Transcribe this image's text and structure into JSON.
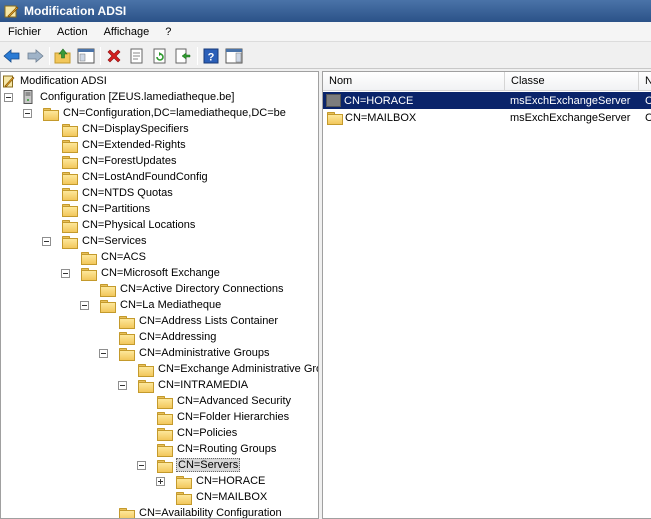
{
  "window": {
    "title": "Modification ADSI"
  },
  "menu": {
    "items": [
      "Fichier",
      "Action",
      "Affichage",
      "?"
    ]
  },
  "toolbar": {
    "icons": [
      "back-arrow-icon",
      "forward-arrow-icon",
      "up-folder-icon",
      "show-hide-tree-icon",
      "delete-icon",
      "properties-icon",
      "refresh-icon",
      "export-list-icon",
      "help-icon",
      "show-hide-action-pane-icon"
    ],
    "colors": {
      "delete": "#d42020",
      "help": "#2b5fb8",
      "back": "#2a7bd5"
    }
  },
  "tree": {
    "root": "Modification ADSI",
    "nodes": [
      {
        "label": "Configuration [ZEUS.lamediatheque.be]"
      },
      {
        "label": "CN=Configuration,DC=lamediatheque,DC=be"
      },
      {
        "label": "CN=DisplaySpecifiers"
      },
      {
        "label": "CN=Extended-Rights"
      },
      {
        "label": "CN=ForestUpdates"
      },
      {
        "label": "CN=LostAndFoundConfig"
      },
      {
        "label": "CN=NTDS Quotas"
      },
      {
        "label": "CN=Partitions"
      },
      {
        "label": "CN=Physical Locations"
      },
      {
        "label": "CN=Services"
      },
      {
        "label": "CN=ACS"
      },
      {
        "label": "CN=Microsoft Exchange"
      },
      {
        "label": "CN=Active Directory Connections"
      },
      {
        "label": "CN=La Mediatheque"
      },
      {
        "label": "CN=Address Lists Container"
      },
      {
        "label": "CN=Addressing"
      },
      {
        "label": "CN=Administrative Groups"
      },
      {
        "label": "CN=Exchange Administrative Group"
      },
      {
        "label": "CN=INTRAMEDIA"
      },
      {
        "label": "CN=Advanced Security"
      },
      {
        "label": "CN=Folder Hierarchies"
      },
      {
        "label": "CN=Policies"
      },
      {
        "label": "CN=Routing Groups"
      },
      {
        "label": "CN=Servers",
        "selected": true
      },
      {
        "label": "CN=HORACE"
      },
      {
        "label": "CN=MAILBOX"
      },
      {
        "label": "CN=Availability Configuration"
      }
    ]
  },
  "list": {
    "columns": [
      "Nom",
      "Classe",
      "N"
    ],
    "rows": [
      {
        "name": "CN=HORACE",
        "class": "msExchExchangeServer",
        "extra": "C",
        "selected": true
      },
      {
        "name": "CN=MAILBOX",
        "class": "msExchExchangeServer",
        "extra": "C"
      }
    ]
  },
  "colors": {
    "selection": "#0a246a",
    "titlebar": "#2b5288"
  }
}
